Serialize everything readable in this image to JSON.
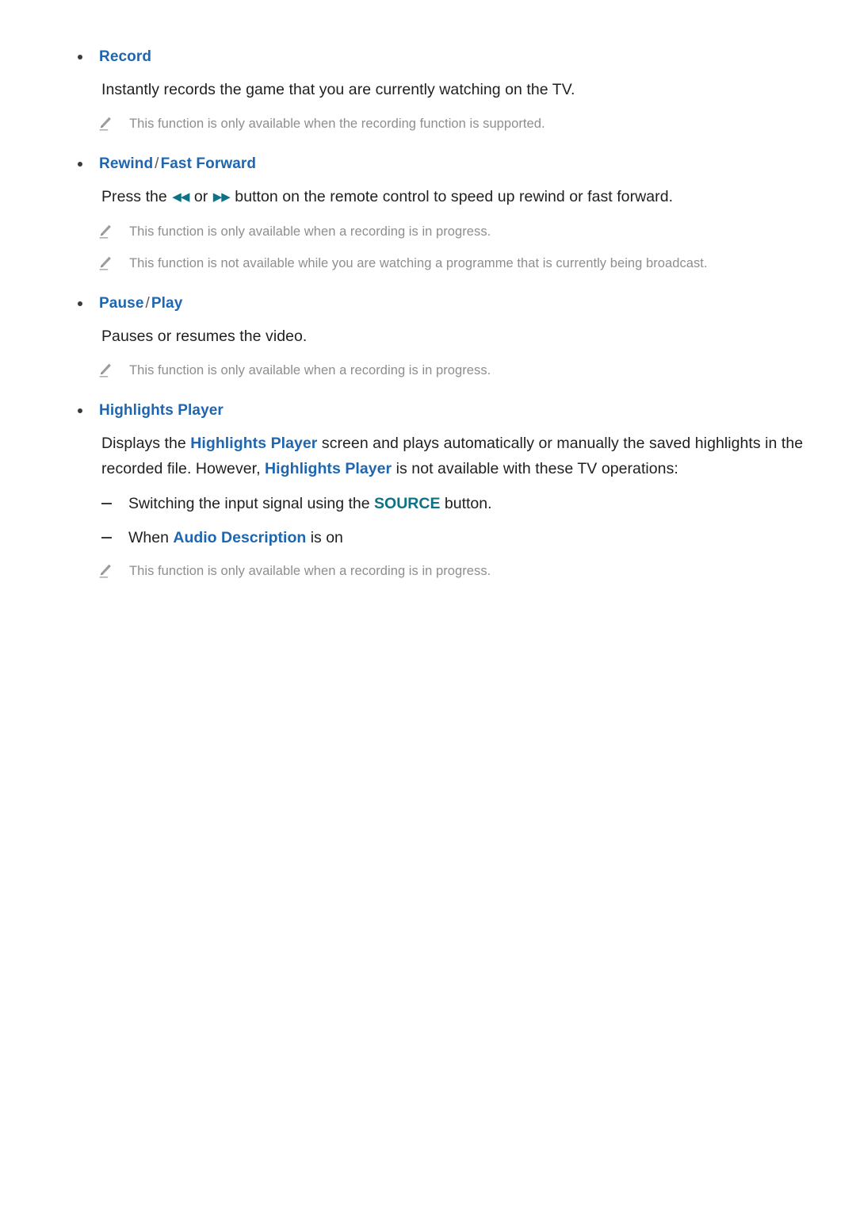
{
  "document": {
    "type": "e-manual-page",
    "colors": {
      "heading_blue": "#1f66b0",
      "accent_teal": "#0d7284",
      "body_text": "#1f1f1f",
      "note_text": "#8e8e8e",
      "background": "#ffffff"
    }
  },
  "sections": [
    {
      "id": "record",
      "heading": "Record",
      "heading_parts": {
        "first": "Record",
        "separator": "",
        "second": ""
      },
      "body": "Instantly records the game that you are currently watching on the TV.",
      "notes": [
        "This function is only available when the recording function is supported."
      ]
    },
    {
      "id": "rewind-fast-forward",
      "heading": "Rewind / Fast Forward",
      "heading_parts": {
        "first": "Rewind",
        "separator": "/",
        "second": "Fast Forward"
      },
      "body_before": "Press the ",
      "glyph_rewind": "◀◀",
      "body_middle": " or ",
      "glyph_forward": "▶▶",
      "body_after": " button on the remote control to speed up rewind or fast forward.",
      "notes": [
        "This function is only available when a recording is in progress.",
        "This function is not available while you are watching a programme that is currently being broadcast."
      ]
    },
    {
      "id": "pause-play",
      "heading": "Pause / Play",
      "heading_parts": {
        "first": "Pause",
        "separator": "/",
        "second": "Play"
      },
      "body": "Pauses or resumes the video.",
      "notes": [
        "This function is only available when a recording is in progress."
      ]
    },
    {
      "id": "highlights-player",
      "heading": "Highlights Player",
      "heading_parts": {
        "first": "Highlights Player",
        "separator": "",
        "second": ""
      },
      "body_seg_1": "Displays the ",
      "body_kw_1": "Highlights Player",
      "body_seg_2": " screen and plays automatically or manually the saved highlights in the recorded file. However, ",
      "body_kw_2": "Highlights Player",
      "body_seg_3": " is not available with these TV operations:",
      "sub_items": [
        {
          "before": "Switching the input signal using the ",
          "keyword": "SOURCE",
          "keyword_style": "teal",
          "after": " button."
        },
        {
          "before": "When ",
          "keyword": "Audio Description",
          "keyword_style": "blue",
          "after": " is on"
        }
      ],
      "notes": [
        "This function is only available when a recording is in progress."
      ]
    }
  ],
  "icons": {
    "note": "pencil-icon",
    "bullet": "bullet-dot-icon",
    "dash": "dash-marker-icon",
    "rewind": "rewind-double-triangle-icon",
    "fast_forward": "fast-forward-double-triangle-icon"
  }
}
